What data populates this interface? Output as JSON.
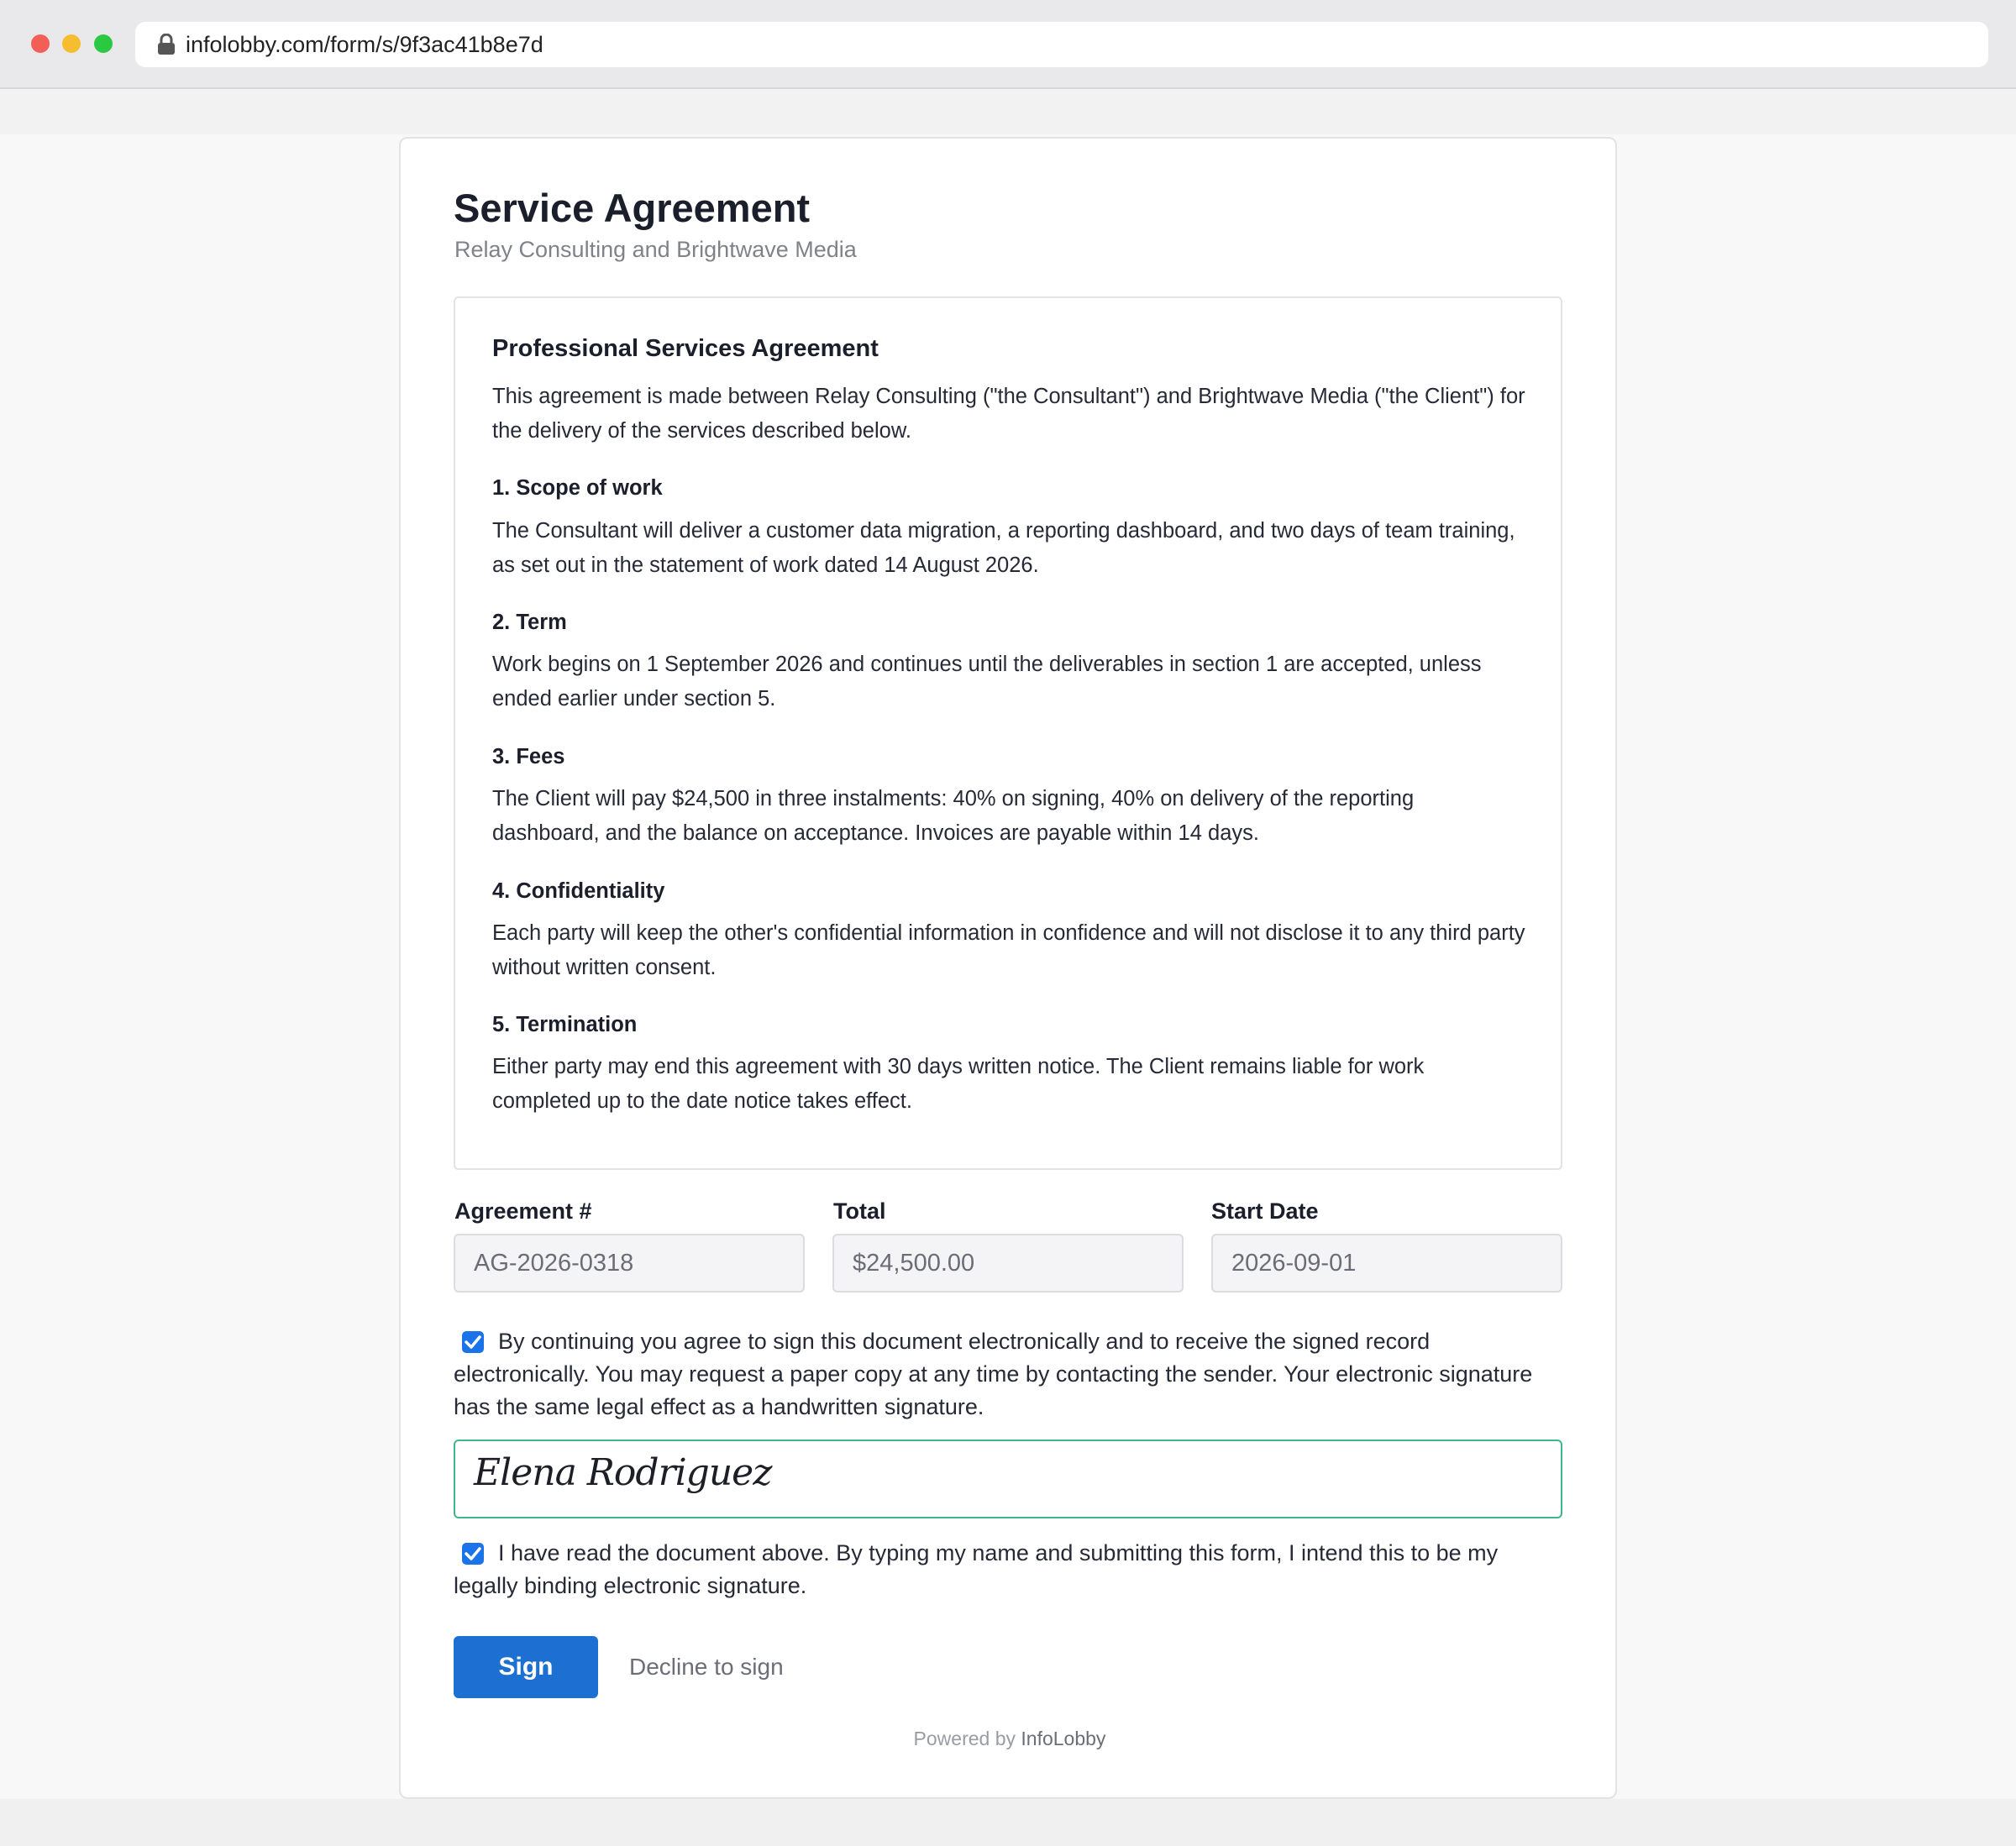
{
  "browser": {
    "url": "infolobby.com/form/s/9f3ac41b8e7d"
  },
  "header": {
    "title": "Service Agreement",
    "subtitle": "Relay Consulting and Brightwave Media"
  },
  "document": {
    "title": "Professional Services Agreement",
    "intro": "This agreement is made between Relay Consulting (\"the Consultant\") and Brightwave Media (\"the Client\") for the delivery of the services described below.",
    "sections": [
      {
        "heading": "1. Scope of work",
        "body": "The Consultant will deliver a customer data migration, a reporting dashboard, and two days of team training, as set out in the statement of work dated 14 August 2026."
      },
      {
        "heading": "2. Term",
        "body": "Work begins on 1 September 2026 and continues until the deliverables in section 1 are accepted, unless ended earlier under section 5."
      },
      {
        "heading": "3. Fees",
        "body": "The Client will pay $24,500 in three instalments: 40% on signing, 40% on delivery of the reporting dashboard, and the balance on acceptance. Invoices are payable within 14 days."
      },
      {
        "heading": "4. Confidentiality",
        "body": "Each party will keep the other's confidential information in confidence and will not disclose it to any third party without written consent."
      },
      {
        "heading": "5. Termination",
        "body": "Either party may end this agreement with 30 days written notice. The Client remains liable for work completed up to the date notice takes effect."
      }
    ]
  },
  "fields": [
    {
      "label": "Agreement #",
      "value": "AG-2026-0318"
    },
    {
      "label": "Total",
      "value": "$24,500.00"
    },
    {
      "label": "Start Date",
      "value": "2026-09-01"
    }
  ],
  "consent": {
    "checked": true,
    "text": "By continuing you agree to sign this document electronically and to receive the signed record electronically. You may request a paper copy at any time by contacting the sender. Your electronic signature has the same legal effect as a handwritten signature."
  },
  "signature": {
    "value": "Elena Rodriguez"
  },
  "attest": {
    "checked": true,
    "text": "I have read the document above. By typing my name and submitting this form, I intend this to be my legally binding electronic signature."
  },
  "actions": {
    "sign_label": "Sign",
    "decline_label": "Decline to sign"
  },
  "footer": {
    "powered_prefix": "Powered by",
    "brand": "InfoLobby"
  },
  "colors": {
    "primary_button": "#1d70d1",
    "checkbox": "#1a73e8",
    "signature_border": "#3cb889"
  }
}
